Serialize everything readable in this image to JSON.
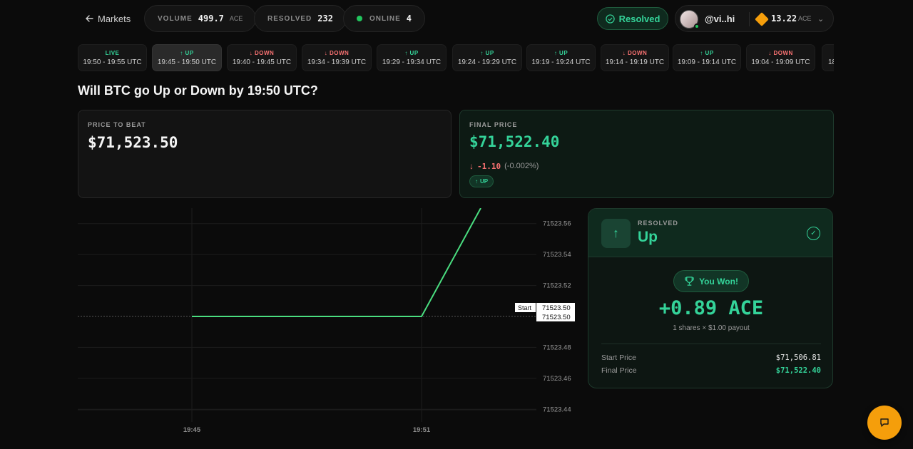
{
  "header": {
    "back_label": "Markets",
    "volume": {
      "label": "VOLUME",
      "value": "499.7",
      "unit": "ACE"
    },
    "resolved": {
      "label": "RESOLVED",
      "value": "232"
    },
    "online": {
      "label": "ONLINE",
      "value": "4"
    },
    "status_label": "Resolved",
    "user": {
      "name": "@vi..hi",
      "balance": "13.22",
      "unit": "ACE"
    }
  },
  "intervals": [
    {
      "direction": "LIVE",
      "type": "live",
      "time": "19:50 - 19:55 UTC",
      "active": false
    },
    {
      "direction": "UP",
      "type": "up",
      "time": "19:45 - 19:50 UTC",
      "active": true
    },
    {
      "direction": "DOWN",
      "type": "down",
      "time": "19:40 - 19:45 UTC",
      "active": false
    },
    {
      "direction": "DOWN",
      "type": "down",
      "time": "19:34 - 19:39 UTC",
      "active": false
    },
    {
      "direction": "UP",
      "type": "up",
      "time": "19:29 - 19:34 UTC",
      "active": false
    },
    {
      "direction": "UP",
      "type": "up",
      "time": "19:24 - 19:29 UTC",
      "active": false
    },
    {
      "direction": "UP",
      "type": "up",
      "time": "19:19 - 19:24 UTC",
      "active": false
    },
    {
      "direction": "DOWN",
      "type": "down",
      "time": "19:14 - 19:19 UTC",
      "active": false
    },
    {
      "direction": "UP",
      "type": "up",
      "time": "19:09 - 19:14 UTC",
      "active": false
    },
    {
      "direction": "DOWN",
      "type": "down",
      "time": "19:04 - 19:09 UTC",
      "active": false
    },
    {
      "direction": "",
      "type": "none",
      "time": "18",
      "active": false
    }
  ],
  "question": "Will BTC go Up or Down by 19:50 UTC?",
  "price_to_beat": {
    "label": "PRICE TO BEAT",
    "value": "$71,523.50"
  },
  "final_price": {
    "label": "FINAL PRICE",
    "value": "$71,522.40",
    "delta": "-1.10",
    "pct": "(-0.002%)",
    "badge": "UP"
  },
  "chart": {
    "start_label": "Start",
    "start_value_1": "71523.50",
    "start_value_2": "71523.50",
    "y_ticks": [
      "71523.56",
      "71523.54",
      "71523.52",
      "71523.48",
      "71523.46",
      "71523.44"
    ],
    "x_ticks": [
      "19:45",
      "19:51"
    ]
  },
  "chart_data": {
    "type": "line",
    "title": "",
    "xlabel": "",
    "ylabel": "",
    "x": [
      "19:45",
      "19:51",
      "19:52"
    ],
    "series": [
      {
        "values": [
          71523.5,
          71523.5,
          71523.57
        ]
      }
    ],
    "baseline": 71523.5,
    "ylim": [
      71523.43,
      71523.57
    ],
    "grid": true,
    "color": "#4ade80"
  },
  "result": {
    "label": "RESOLVED",
    "value": "Up",
    "won_label": "You Won!",
    "payout": "+0.89 ACE",
    "shares_text": "1 shares × $1.00 payout",
    "start_price_label": "Start Price",
    "start_price": "$71,506.81",
    "final_price_label": "Final Price",
    "final_price": "$71,522.40"
  },
  "colors": {
    "accent": "#34d399",
    "down": "#f87171",
    "coin": "#f59e0b",
    "background": "#0b0b0b"
  }
}
